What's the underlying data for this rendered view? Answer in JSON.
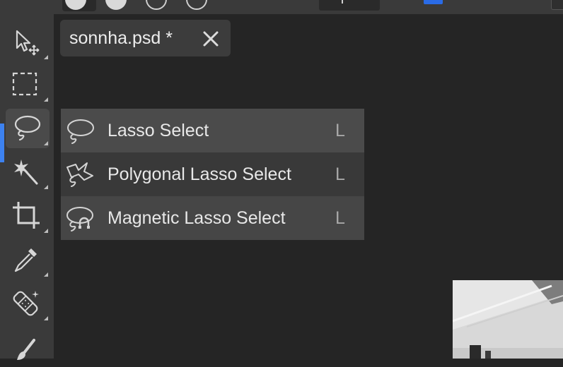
{
  "topbar": {
    "shape_options": [
      "filled-circle",
      "filled-circle",
      "outline-circle",
      "outline-circle"
    ],
    "accent_color": "#2a6be6"
  },
  "toolbar": {
    "active_tool": "lasso",
    "active_color": "#3d82f0",
    "tools": [
      {
        "name": "move-tool",
        "icon": "move-arrow-icon"
      },
      {
        "name": "marquee-tool",
        "icon": "marquee-rect-icon"
      },
      {
        "name": "lasso-tool",
        "icon": "lasso-icon"
      },
      {
        "name": "magic-wand-tool",
        "icon": "magic-wand-icon"
      },
      {
        "name": "crop-tool",
        "icon": "crop-icon"
      },
      {
        "name": "eyedropper-tool",
        "icon": "eyedropper-icon"
      },
      {
        "name": "healing-tool",
        "icon": "bandage-icon"
      },
      {
        "name": "brush-tool",
        "icon": "brush-icon"
      }
    ]
  },
  "document_tab": {
    "title": "sonnha.psd *",
    "close_icon": "close-icon"
  },
  "lasso_menu": {
    "items": [
      {
        "label": "Lasso Select",
        "shortcut": "L",
        "icon": "lasso-icon"
      },
      {
        "label": "Polygonal Lasso Select",
        "shortcut": "L",
        "icon": "polygonal-lasso-icon"
      },
      {
        "label": "Magnetic Lasso Select",
        "shortcut": "L",
        "icon": "magnetic-lasso-icon"
      }
    ]
  }
}
